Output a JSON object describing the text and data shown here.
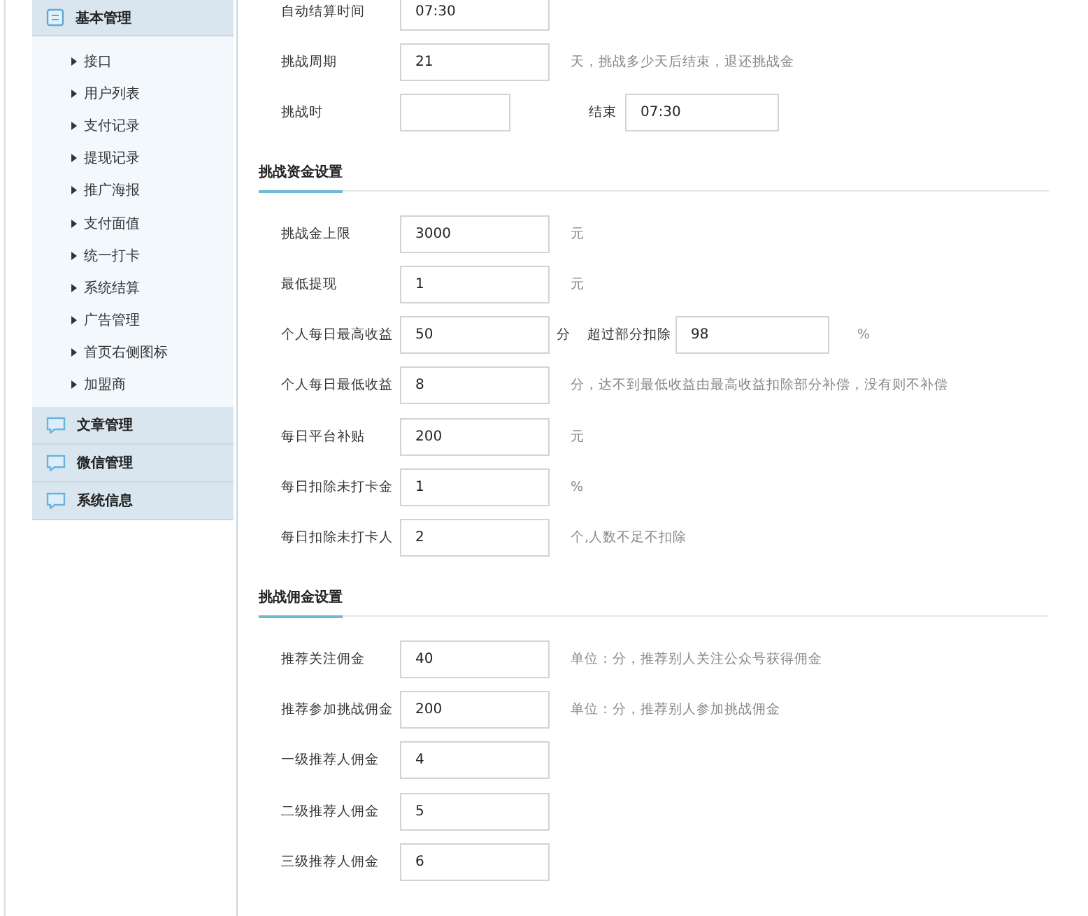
{
  "sidebar": {
    "groups": [
      {
        "label": "基本管理",
        "expanded": true,
        "items": [
          "接口",
          "用户列表",
          "支付记录",
          "提现记录",
          "推广海报",
          "支付面值",
          "统一打卡",
          "系统结算",
          "广告管理",
          "首页右侧图标",
          "加盟商"
        ]
      },
      {
        "label": "文章管理",
        "expanded": false
      },
      {
        "label": "微信管理",
        "expanded": false
      },
      {
        "label": "系统信息",
        "expanded": false
      }
    ]
  },
  "sections": [
    {
      "rows": [
        {
          "kind": "single",
          "label": "自动结算时间",
          "value": "07:30"
        },
        {
          "kind": "single",
          "label": "挑战周期",
          "value": "21",
          "hint": "天，挑战多少天后结束，退还挑战金"
        },
        {
          "kind": "pair",
          "label": "挑战时",
          "label2": "结束",
          "value2": "07:30"
        }
      ]
    },
    {
      "title": "挑战资金设置",
      "rows": [
        {
          "kind": "single",
          "label": "挑战金上限",
          "value": "3000",
          "hint": "元"
        },
        {
          "kind": "single",
          "label": "最低提现",
          "value": "1",
          "hint": "元"
        },
        {
          "kind": "pair",
          "label": "个人每日最高收益",
          "value": "50",
          "unit": "分",
          "label2": "超过部分扣除",
          "value2": "98",
          "hint": "%"
        },
        {
          "kind": "single",
          "label": "个人每日最低收益",
          "value": "8",
          "hint": "分，达不到最低收益由最高收益扣除部分补偿，没有则不补偿"
        },
        {
          "kind": "single",
          "label": "每日平台补贴",
          "value": "200",
          "hint": "元"
        },
        {
          "kind": "single",
          "label": "每日扣除未打卡金",
          "value": "1",
          "hint": "%"
        },
        {
          "kind": "single",
          "label": "每日扣除未打卡人",
          "value": "2",
          "hint": "个,人数不足不扣除"
        }
      ]
    },
    {
      "title": "挑战佣金设置",
      "rows": [
        {
          "kind": "single",
          "label": "推荐关注佣金",
          "value": "40",
          "hint": "单位：分，推荐别人关注公众号获得佣金"
        },
        {
          "kind": "single",
          "label": "推荐参加挑战佣金",
          "value": "200",
          "hint": "单位：分，推荐别人参加挑战佣金"
        },
        {
          "kind": "single",
          "label": "一级推荐人佣金",
          "value": "4"
        },
        {
          "kind": "single",
          "label": "二级推荐人佣金",
          "value": "5"
        },
        {
          "kind": "single",
          "label": "三级推荐人佣金",
          "value": "6"
        }
      ]
    }
  ]
}
